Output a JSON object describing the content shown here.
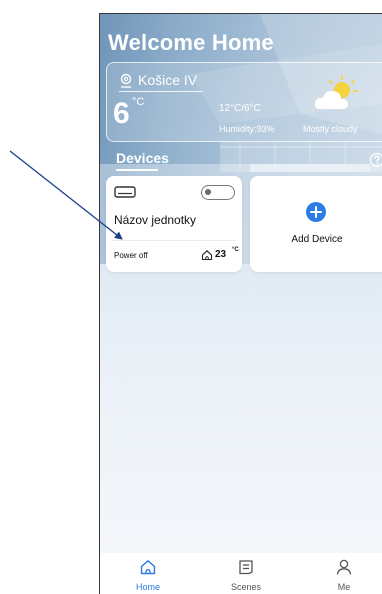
{
  "header": {
    "title": "Welcome Home"
  },
  "weather": {
    "location": "Košice IV",
    "temperature": "6",
    "temperature_unit": "°C",
    "hi_lo": "12°C/6°C",
    "humidity": "Humidity:93%",
    "condition": "Mostly cloudy",
    "icon": "partly-cloudy-icon"
  },
  "devices_section": {
    "title": "Devices",
    "help_icon": "help-icon"
  },
  "device_card": {
    "name": "Názov jednotky",
    "status": "Power off",
    "temperature": "23",
    "temperature_unit": "°C",
    "power_on": false,
    "icon": "air-conditioner-icon"
  },
  "add_device": {
    "label": "Add Device",
    "icon": "plus-icon"
  },
  "bottom_nav": {
    "items": [
      {
        "label": "Home",
        "icon": "home-icon",
        "active": true
      },
      {
        "label": "Scenes",
        "icon": "scenes-icon",
        "active": false
      },
      {
        "label": "Me",
        "icon": "user-icon",
        "active": false
      }
    ]
  },
  "colors": {
    "accent": "#2d7be5",
    "inactive": "#555555",
    "annotation_arrow": "#1c3f8a"
  }
}
